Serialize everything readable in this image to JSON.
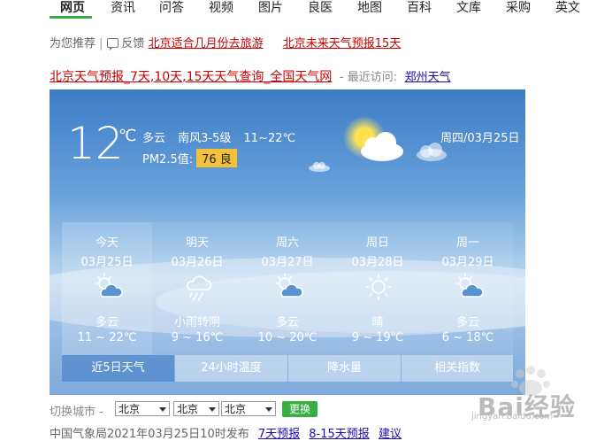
{
  "nav": {
    "items": [
      "网页",
      "资讯",
      "问答",
      "视频",
      "图片",
      "良医",
      "地图",
      "百科",
      "文库",
      "采购",
      "英文"
    ],
    "active": "网页"
  },
  "recommend": {
    "label": "为您推荐",
    "feedback": "反馈",
    "links": [
      "北京适合几月份去旅游",
      "北京未来天气预报15天"
    ]
  },
  "result": {
    "title": "北京天气预报_7天,10天,15天天气查询_全国天气网",
    "recent_label": "- 最近访问:",
    "recent_city": "郑州天气"
  },
  "current": {
    "temp": "12",
    "unit": "℃",
    "condition": "多云",
    "wind": "南风3-5级",
    "range": "11~22℃",
    "pm_label": "PM2.5值:",
    "aqi": "76 良",
    "date": "周四/03月25日"
  },
  "forecast": [
    {
      "name": "今天",
      "date": "03月25日",
      "icon": "partly-cloudy-icon",
      "cond": "多云",
      "range": "11 ~ 22℃"
    },
    {
      "name": "明天",
      "date": "03月26日",
      "icon": "light-rain-icon",
      "cond": "小雨转阴",
      "range": "9 ~ 16℃"
    },
    {
      "name": "周六",
      "date": "03月27日",
      "icon": "partly-cloudy-icon",
      "cond": "多云",
      "range": "10 ~ 20℃"
    },
    {
      "name": "周日",
      "date": "03月28日",
      "icon": "sunny-icon",
      "cond": "晴",
      "range": "9 ~ 19℃"
    },
    {
      "name": "周一",
      "date": "03月29日",
      "icon": "partly-cloudy-icon",
      "cond": "多云",
      "range": "6 ~ 18℃"
    }
  ],
  "tabs": [
    "近5日天气",
    "24小时温度",
    "降水量",
    "相关指数"
  ],
  "switch": {
    "label": "切换城市 -",
    "selects": [
      "北京",
      "北京",
      "北京"
    ],
    "button": "更换"
  },
  "footer": {
    "text": "中国气象局2021年03月25日10时发布",
    "links": [
      "7天预报",
      "8-15天预报",
      "建议"
    ]
  },
  "watermark": {
    "text": "Bai经验",
    "sub": "jingyan.baidu.com"
  },
  "colors": {
    "accent": "#38b03f",
    "link_red": "#cc0000",
    "link_blue": "#1a0dab",
    "aqi": "#f3c13a"
  }
}
